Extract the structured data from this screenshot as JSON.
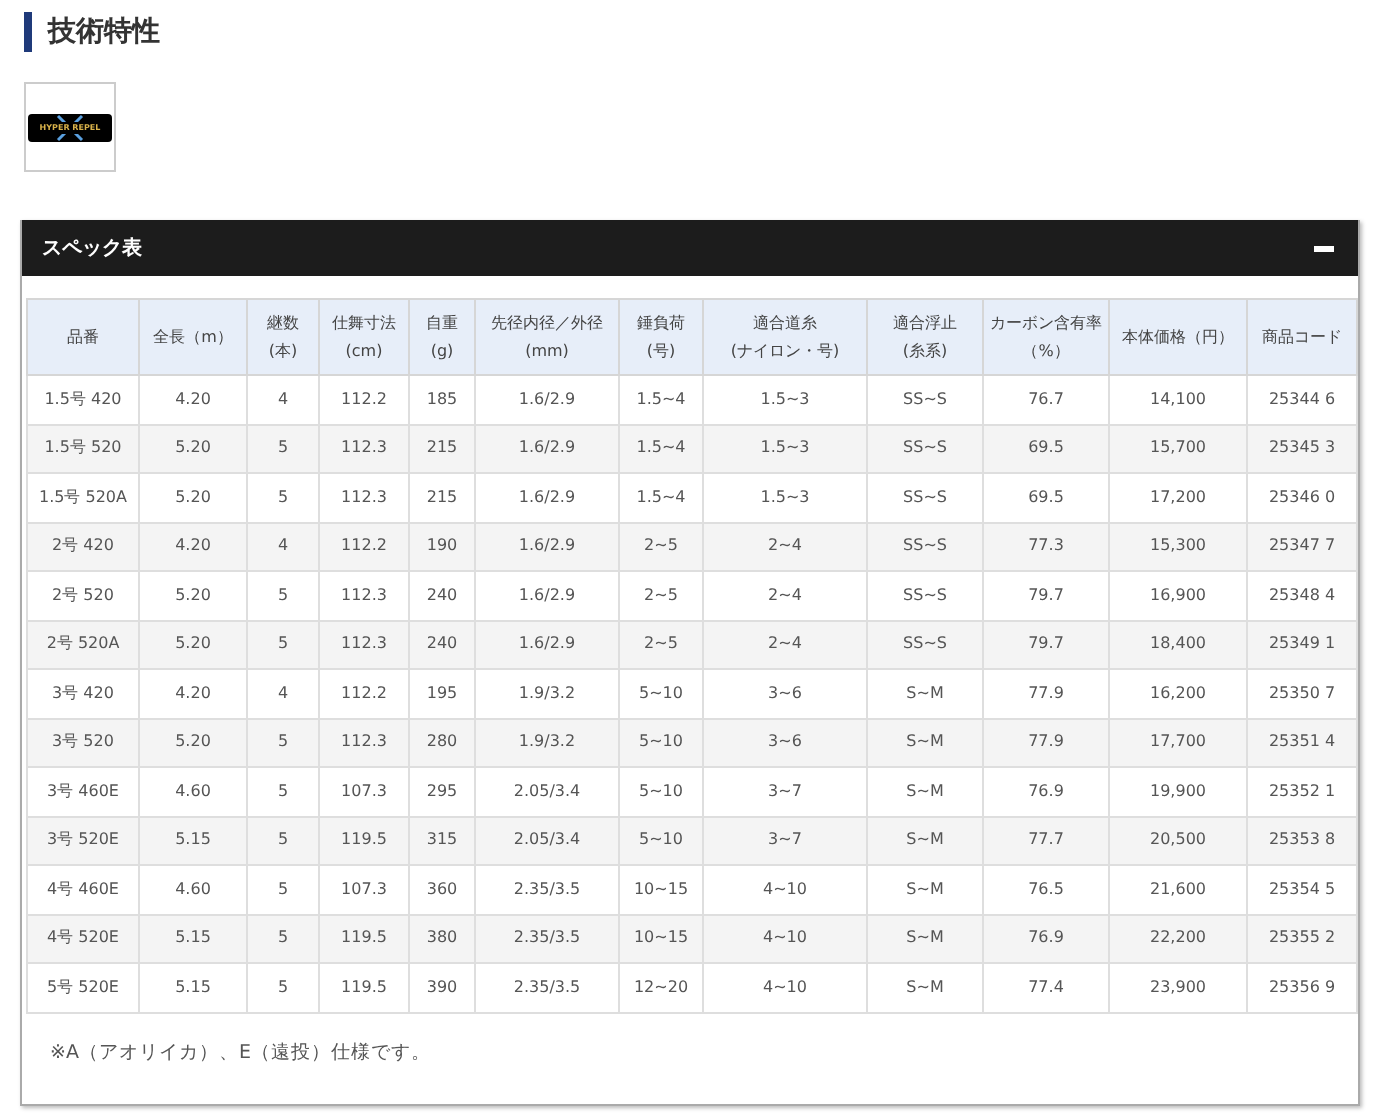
{
  "section": {
    "title": "技術特性"
  },
  "logo": {
    "text": "HYPER REPEL"
  },
  "spec_panel": {
    "title": "スペック表",
    "expanded": true,
    "columns": [
      "品番",
      "全長（m）",
      "継数\n(本)",
      "仕舞寸法\n(cm)",
      "自重\n(g)",
      "先径内径／外径\n(mm)",
      "錘負荷\n(号)",
      "適合道糸\n(ナイロン・号)",
      "適合浮止\n(糸系)",
      "カーボン含有率（%）",
      "本体価格（円）",
      "商品コード"
    ],
    "rows": [
      [
        "1.5号 420",
        "4.20",
        "4",
        "112.2",
        "185",
        "1.6/2.9",
        "1.5~4",
        "1.5~3",
        "SS~S",
        "76.7",
        "14,100",
        "25344 6"
      ],
      [
        "1.5号 520",
        "5.20",
        "5",
        "112.3",
        "215",
        "1.6/2.9",
        "1.5~4",
        "1.5~3",
        "SS~S",
        "69.5",
        "15,700",
        "25345 3"
      ],
      [
        "1.5号 520A",
        "5.20",
        "5",
        "112.3",
        "215",
        "1.6/2.9",
        "1.5~4",
        "1.5~3",
        "SS~S",
        "69.5",
        "17,200",
        "25346 0"
      ],
      [
        "2号 420",
        "4.20",
        "4",
        "112.2",
        "190",
        "1.6/2.9",
        "2~5",
        "2~4",
        "SS~S",
        "77.3",
        "15,300",
        "25347 7"
      ],
      [
        "2号 520",
        "5.20",
        "5",
        "112.3",
        "240",
        "1.6/2.9",
        "2~5",
        "2~4",
        "SS~S",
        "79.7",
        "16,900",
        "25348 4"
      ],
      [
        "2号 520A",
        "5.20",
        "5",
        "112.3",
        "240",
        "1.6/2.9",
        "2~5",
        "2~4",
        "SS~S",
        "79.7",
        "18,400",
        "25349 1"
      ],
      [
        "3号 420",
        "4.20",
        "4",
        "112.2",
        "195",
        "1.9/3.2",
        "5~10",
        "3~6",
        "S~M",
        "77.9",
        "16,200",
        "25350 7"
      ],
      [
        "3号 520",
        "5.20",
        "5",
        "112.3",
        "280",
        "1.9/3.2",
        "5~10",
        "3~6",
        "S~M",
        "77.9",
        "17,700",
        "25351 4"
      ],
      [
        "3号 460E",
        "4.60",
        "5",
        "107.3",
        "295",
        "2.05/3.4",
        "5~10",
        "3~7",
        "S~M",
        "76.9",
        "19,900",
        "25352 1"
      ],
      [
        "3号 520E",
        "5.15",
        "5",
        "119.5",
        "315",
        "2.05/3.4",
        "5~10",
        "3~7",
        "S~M",
        "77.7",
        "20,500",
        "25353 8"
      ],
      [
        "4号 460E",
        "4.60",
        "5",
        "107.3",
        "360",
        "2.35/3.5",
        "10~15",
        "4~10",
        "S~M",
        "76.5",
        "21,600",
        "25354 5"
      ],
      [
        "4号 520E",
        "5.15",
        "5",
        "119.5",
        "380",
        "2.35/3.5",
        "10~15",
        "4~10",
        "S~M",
        "76.9",
        "22,200",
        "25355 2"
      ],
      [
        "5号 520E",
        "5.15",
        "5",
        "119.5",
        "390",
        "2.35/3.5",
        "12~20",
        "4~10",
        "S~M",
        "77.4",
        "23,900",
        "25356 9"
      ]
    ],
    "note": "※A（アオリイカ）、E（遠投）仕様です。"
  }
}
